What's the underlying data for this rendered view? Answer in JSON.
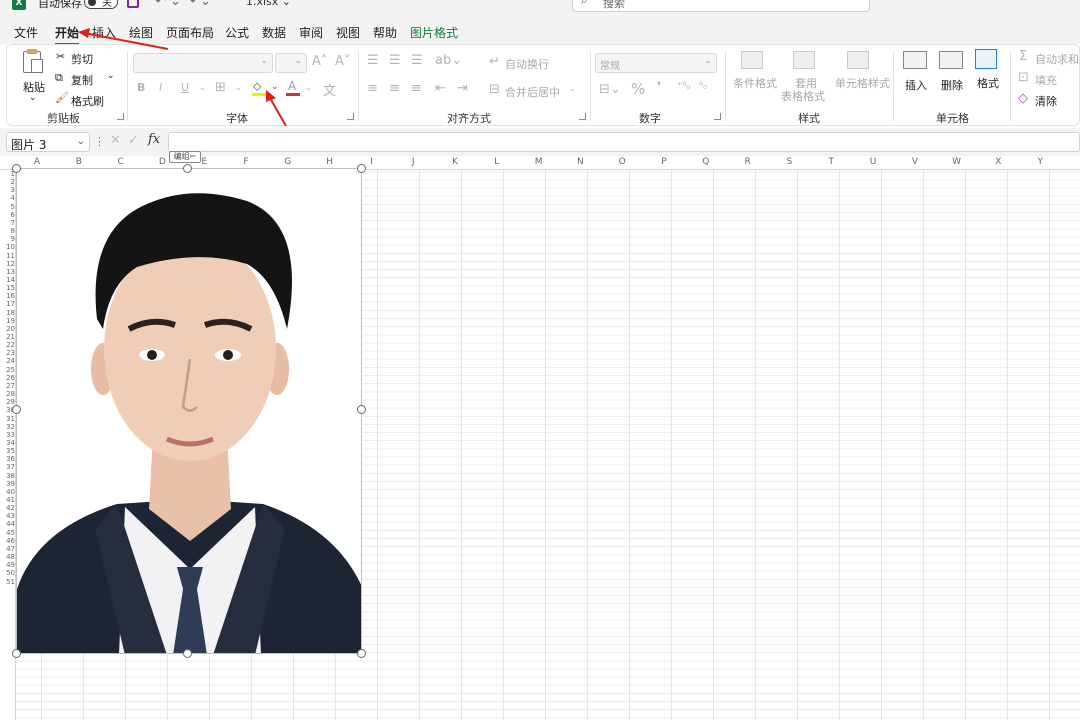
{
  "titlebar": {
    "logo": "X",
    "autosave_label": "自动保存",
    "toggle_text": "关",
    "filename": "1.xlsx ⌄",
    "search_placeholder": "搜索"
  },
  "tabs": [
    {
      "label": "文件"
    },
    {
      "label": "开始"
    },
    {
      "label": "插入"
    },
    {
      "label": "绘图"
    },
    {
      "label": "页面布局"
    },
    {
      "label": "公式"
    },
    {
      "label": "数据"
    },
    {
      "label": "审阅"
    },
    {
      "label": "视图"
    },
    {
      "label": "帮助"
    },
    {
      "label": "图片格式"
    }
  ],
  "ribbon": {
    "clipboard": {
      "paste": "粘贴",
      "cut": "剪切",
      "copy": "复制",
      "format_painter": "格式刷",
      "label": "剪贴板"
    },
    "font": {
      "label": "字体"
    },
    "alignment": {
      "wrap_text": "自动换行",
      "merge_center": "合并后居中",
      "label": "对齐方式"
    },
    "number": {
      "format_value": "常规",
      "label": "数字"
    },
    "styles": {
      "conditional": "条件格式",
      "table_format_1": "套用",
      "table_format_2": "表格格式",
      "cell_styles": "单元格样式",
      "label": "样式"
    },
    "cells": {
      "insert": "插入",
      "delete": "删除",
      "format": "格式",
      "label": "单元格"
    },
    "editing": {
      "autosum": "自动求和",
      "fill": "填充",
      "clear": "清除"
    }
  },
  "formula_bar": {
    "name_box": "图片 3",
    "fx": "fx"
  },
  "columns": [
    "A",
    "B",
    "C",
    "D",
    "E",
    "F",
    "G",
    "H",
    "I",
    "J",
    "K",
    "L",
    "M",
    "N",
    "O",
    "P",
    "Q",
    "R",
    "S",
    "T",
    "U",
    "V",
    "W",
    "X",
    "Y"
  ],
  "rows": [
    "1",
    "2",
    "3",
    "4",
    "5",
    "6",
    "7",
    "8",
    "9",
    "10",
    "11",
    "12",
    "13",
    "14",
    "15",
    "16",
    "17",
    "18",
    "19",
    "20",
    "21",
    "22",
    "23",
    "24",
    "25",
    "26",
    "27",
    "28",
    "29",
    "30",
    "31",
    "32",
    "33",
    "34",
    "35",
    "36",
    "37",
    "38",
    "39",
    "40",
    "41",
    "42",
    "43",
    "44",
    "45",
    "46",
    "47",
    "48",
    "49",
    "50",
    "51"
  ],
  "tooltip": "编组⌐",
  "colors": {
    "accent": "#107c41",
    "arrow": "#e02020"
  }
}
